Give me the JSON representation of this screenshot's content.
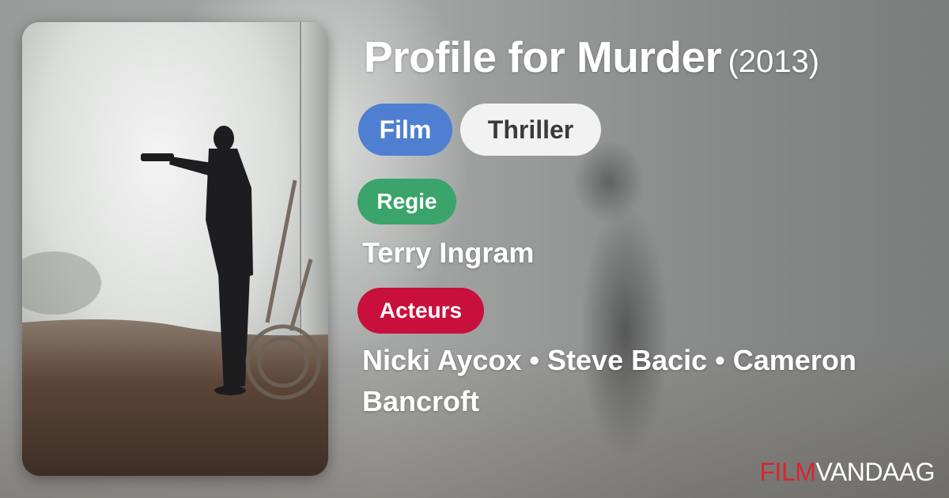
{
  "movie": {
    "title": "Profile for Murder",
    "year": "(2013)"
  },
  "tags": {
    "type": "Film",
    "genre": "Thriller"
  },
  "director": {
    "label": "Regie",
    "name": "Terry Ingram"
  },
  "cast": {
    "label": "Acteurs",
    "names": "Nicki Aycox • Steve Bacic • Cameron Bancroft"
  },
  "brand": {
    "part1": "FILM",
    "part2": "VANDAAG"
  },
  "colors": {
    "film_chip": "#4f7fd1",
    "genre_chip": "#f2f2f2",
    "regie_label": "#3aa46b",
    "acteurs_label": "#c9103c",
    "brand_red": "#d7262f"
  }
}
